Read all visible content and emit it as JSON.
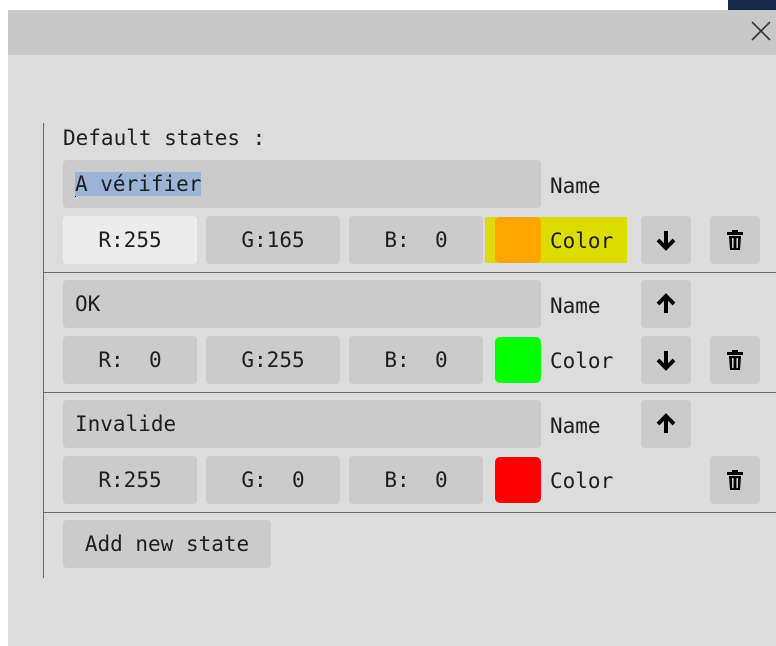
{
  "dialog": {
    "close_icon": "close-icon"
  },
  "section": {
    "title": "Default states :",
    "add_button_label": "Add new state"
  },
  "states": [
    {
      "name": "A vérifier",
      "name_label": "Name",
      "r": "R:255",
      "g": "G:165",
      "b": "B:  0",
      "color_hex": "#ffa500",
      "color_label": "Color",
      "has_up": false,
      "has_down": true,
      "has_delete": true
    },
    {
      "name": "OK",
      "name_label": "Name",
      "r": "R:  0",
      "g": "G:255",
      "b": "B:  0",
      "color_hex": "#00ff00",
      "color_label": "Color",
      "has_up": true,
      "has_down": true,
      "has_delete": true
    },
    {
      "name": "Invalide",
      "name_label": "Name",
      "r": "R:255",
      "g": "G:  0",
      "b": "B:  0",
      "color_hex": "#ff0000",
      "color_label": "Color",
      "has_up": true,
      "has_down": false,
      "has_delete": true
    }
  ],
  "icons": {
    "up": "arrow-up-icon",
    "down": "arrow-down-icon",
    "delete": "trash-icon"
  },
  "colors": {
    "background": "#dcdcdc",
    "field": "#cbcbcb",
    "focused_field": "#ececec",
    "selection": "#9ab4d8",
    "hover_highlight": "#dcdc00"
  }
}
